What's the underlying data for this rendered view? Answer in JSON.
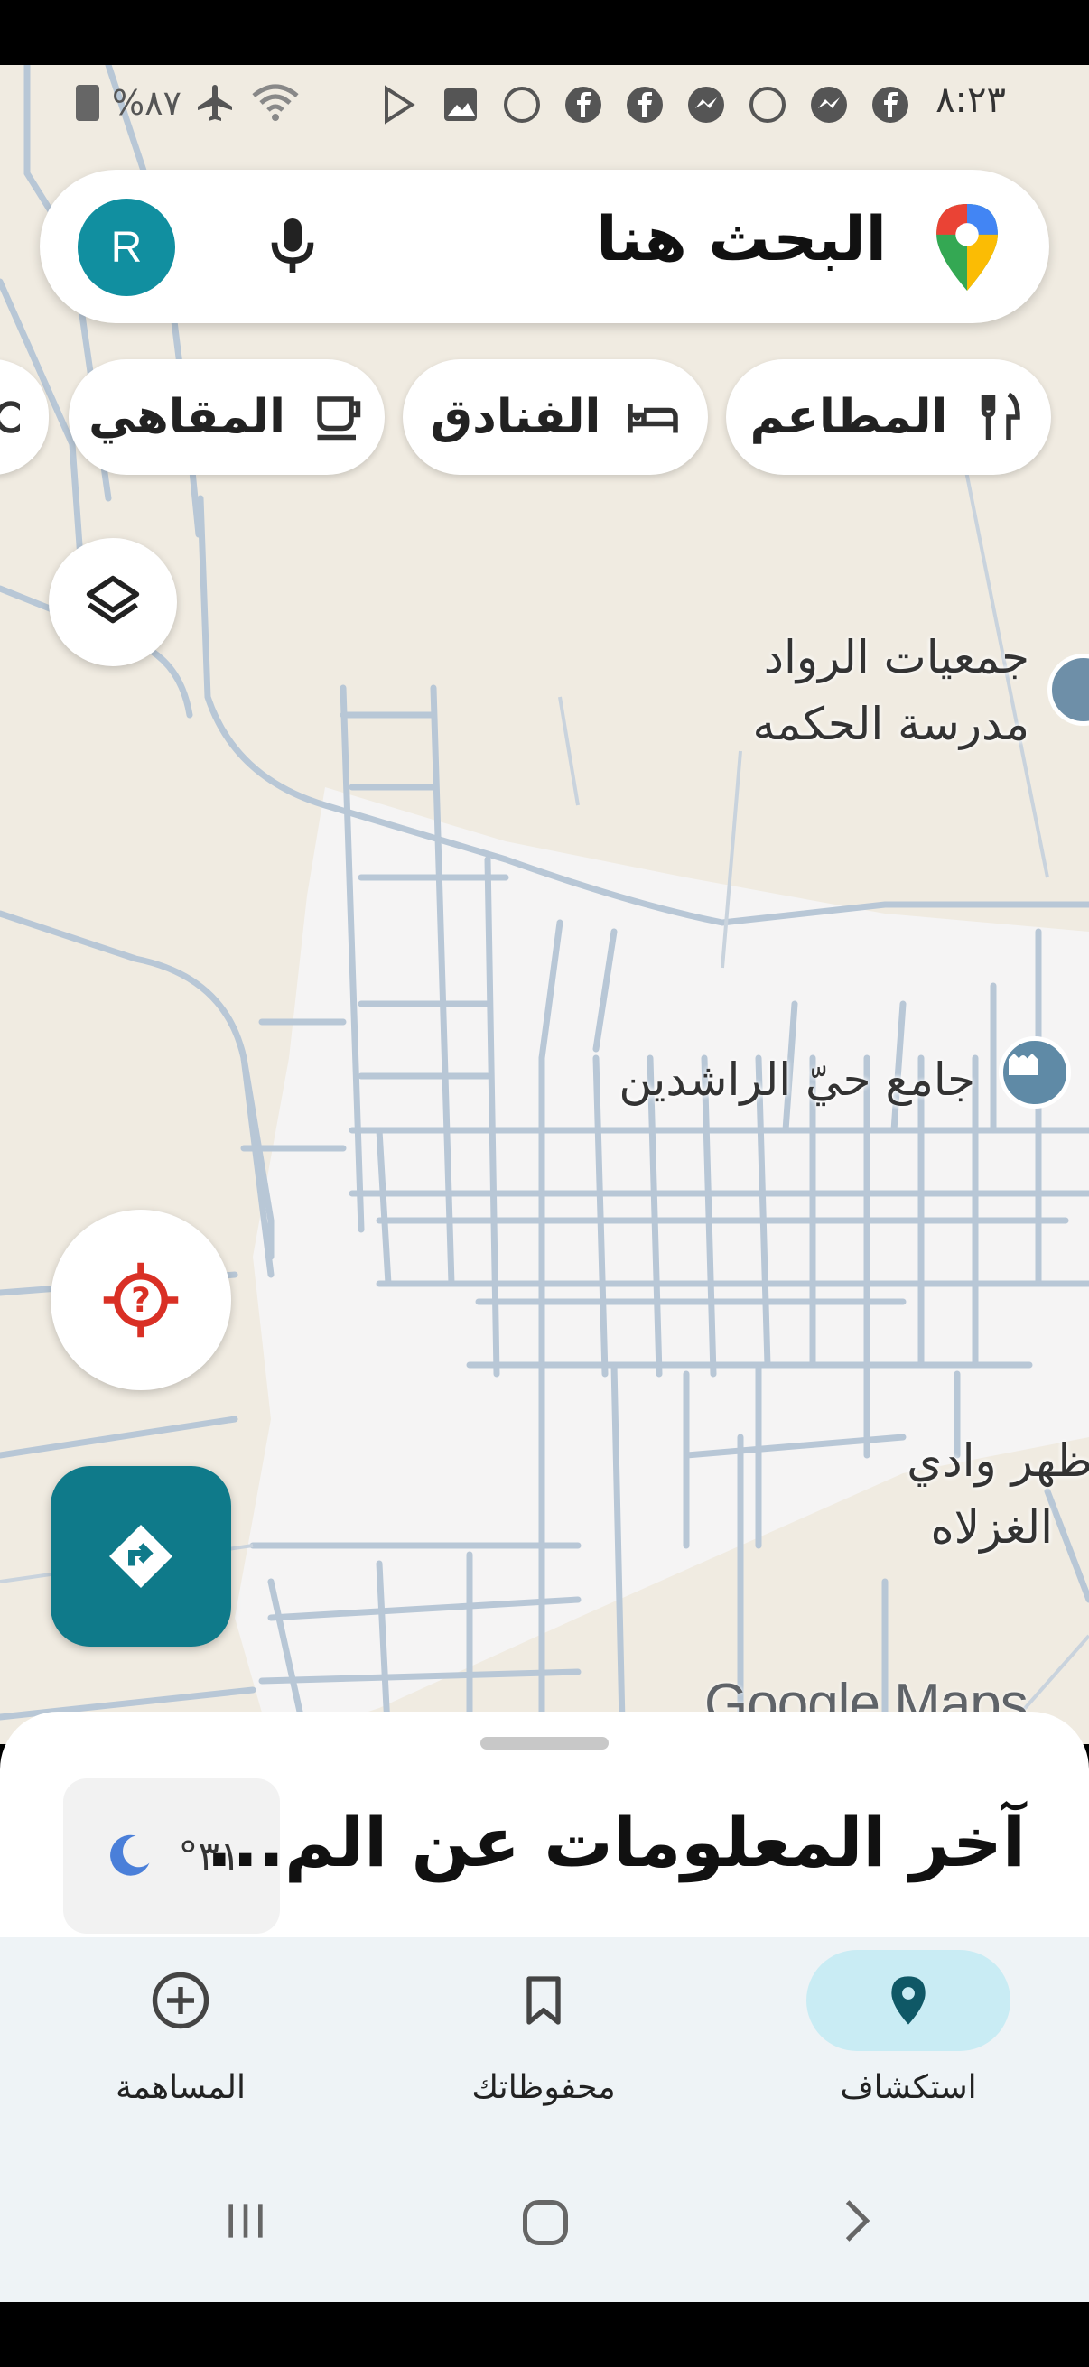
{
  "status_bar": {
    "time": "٨:٢٣",
    "battery": "%٨٧"
  },
  "search": {
    "placeholder": "البحث هنا",
    "avatar_letter": "R"
  },
  "chips": [
    {
      "label": "المطاعم",
      "icon": "fork-knife-icon"
    },
    {
      "label": "الفنادق",
      "icon": "bed-icon"
    },
    {
      "label": "المقاهي",
      "icon": "coffee-icon"
    }
  ],
  "map_labels": {
    "rawwad": "جمعيات الرواد",
    "hikma": "مدرسة الحكمه",
    "mosque": "جامع حيّ الراشدين",
    "wadi_line1": "ظهر وادي",
    "wadi_line2": "الغزلاه"
  },
  "watermark": {
    "google": "Google",
    "maps": "Maps"
  },
  "sheet": {
    "title": "آخر المعلومات عن الم...",
    "weather_temp": "°٣١"
  },
  "bottom_nav": {
    "explore": "استكشاف",
    "saved": "محفوظاتك",
    "contribute": "المساهمة"
  },
  "colors": {
    "accent_teal": "#0f7a8a",
    "avatar_teal": "#118fa0",
    "map_bg": "#f0ebe1",
    "road": "#b8c7d6",
    "explore_pill": "#c9ecf4"
  }
}
